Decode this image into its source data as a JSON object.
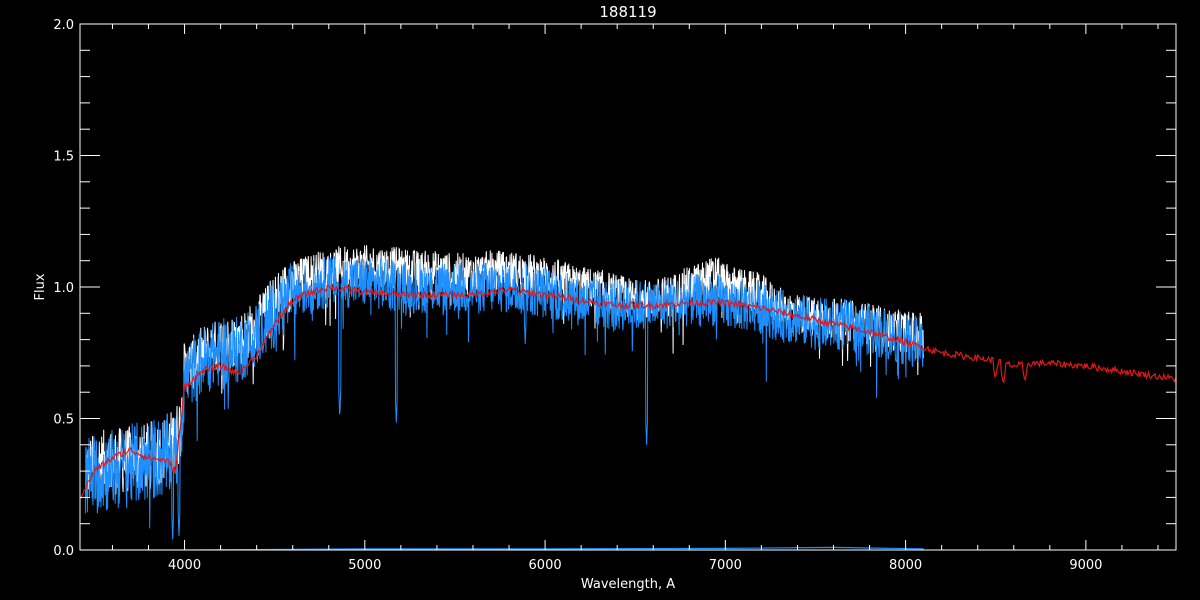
{
  "chart_data": {
    "type": "line",
    "title": "188119",
    "xlabel": "Wavelength, A",
    "ylabel": "Flux",
    "xlim": [
      3420,
      9500
    ],
    "ylim": [
      0,
      2.0
    ],
    "x_ticks": [
      4000,
      5000,
      6000,
      7000,
      8000,
      9000
    ],
    "x_tick_labels": [
      "4000",
      "5000",
      "6000",
      "7000",
      "8000",
      "9000"
    ],
    "y_ticks": [
      0.0,
      0.5,
      1.0,
      1.5,
      2.0
    ],
    "y_tick_labels": [
      "0.0",
      "0.5",
      "1.0",
      "1.5",
      "2.0"
    ],
    "grid": false,
    "background": "#000000",
    "axis_color": "#ffffff",
    "series": [
      {
        "color": "#ffffff",
        "style": "noisy spectrum (upper envelope)",
        "x": [
          3450,
          3550,
          3650,
          3750,
          3850,
          3920,
          3970,
          4000,
          4100,
          4200,
          4300,
          4400,
          4500,
          4600,
          4700,
          4800,
          4900,
          5000,
          5100,
          5200,
          5300,
          5400,
          5500,
          5600,
          5700,
          5800,
          5900,
          6000,
          6100,
          6200,
          6300,
          6400,
          6500,
          6600,
          6700,
          6800,
          6900,
          6950,
          7000,
          7100,
          7200,
          7300,
          7400,
          7500,
          7600,
          7700,
          7800,
          7900,
          8000,
          8100
        ],
        "y": [
          0.3,
          0.33,
          0.34,
          0.35,
          0.37,
          0.4,
          0.45,
          0.68,
          0.75,
          0.78,
          0.8,
          0.85,
          0.95,
          1.02,
          1.05,
          1.07,
          1.08,
          1.08,
          1.08,
          1.07,
          1.06,
          1.06,
          1.05,
          1.05,
          1.06,
          1.06,
          1.05,
          1.04,
          1.02,
          1.0,
          0.99,
          0.97,
          0.95,
          0.95,
          0.97,
          1.0,
          1.03,
          1.04,
          1.01,
          0.99,
          0.97,
          0.92,
          0.9,
          0.88,
          0.88,
          0.87,
          0.86,
          0.84,
          0.83,
          0.83
        ]
      },
      {
        "color": "#1e8fff",
        "style": "observed spectrum",
        "x": [
          3450,
          3550,
          3650,
          3750,
          3850,
          3920,
          3970,
          4000,
          4100,
          4200,
          4300,
          4400,
          4500,
          4600,
          4700,
          4800,
          4900,
          5000,
          5100,
          5200,
          5300,
          5400,
          5500,
          5600,
          5700,
          5800,
          5900,
          6000,
          6100,
          6200,
          6300,
          6400,
          6500,
          6600,
          6700,
          6800,
          6900,
          6950,
          7000,
          7100,
          7200,
          7300,
          7400,
          7500,
          7600,
          7700,
          7800,
          7900,
          8000,
          8100
        ],
        "y": [
          0.28,
          0.3,
          0.31,
          0.33,
          0.35,
          0.36,
          0.4,
          0.65,
          0.72,
          0.75,
          0.76,
          0.82,
          0.9,
          0.97,
          1.0,
          1.02,
          1.02,
          1.02,
          1.01,
          1.0,
          1.0,
          1.0,
          1.0,
          0.99,
          1.0,
          1.0,
          0.99,
          0.98,
          0.96,
          0.95,
          0.94,
          0.93,
          0.93,
          0.93,
          0.94,
          0.95,
          0.95,
          0.95,
          0.94,
          0.93,
          0.92,
          0.89,
          0.88,
          0.86,
          0.86,
          0.85,
          0.84,
          0.82,
          0.8,
          0.78
        ]
      },
      {
        "color": "#e01818",
        "style": "model spectrum",
        "x": [
          3420,
          3500,
          3600,
          3700,
          3800,
          3900,
          3950,
          4000,
          4100,
          4200,
          4300,
          4400,
          4500,
          4600,
          4700,
          4800,
          4900,
          5000,
          5200,
          5400,
          5600,
          5800,
          6000,
          6200,
          6400,
          6600,
          6800,
          7000,
          7200,
          7400,
          7600,
          7800,
          8000,
          8200,
          8400,
          8500,
          8600,
          8700,
          8800,
          9000,
          9200,
          9400,
          9500
        ],
        "y": [
          0.2,
          0.3,
          0.35,
          0.38,
          0.35,
          0.34,
          0.3,
          0.62,
          0.68,
          0.7,
          0.67,
          0.74,
          0.86,
          0.95,
          0.98,
          1.0,
          0.99,
          0.98,
          0.97,
          0.97,
          0.97,
          0.99,
          0.97,
          0.95,
          0.93,
          0.93,
          0.94,
          0.94,
          0.92,
          0.89,
          0.86,
          0.83,
          0.79,
          0.75,
          0.73,
          0.72,
          0.7,
          0.71,
          0.71,
          0.7,
          0.68,
          0.66,
          0.65
        ]
      },
      {
        "color": "#1e8fff",
        "style": "error / residual near zero",
        "x": [
          3420,
          4000,
          5000,
          6000,
          7000,
          7600,
          8100
        ],
        "y": [
          0.0,
          0.0,
          0.004,
          0.004,
          0.006,
          0.01,
          0.004
        ]
      }
    ],
    "absorption_features": [
      {
        "x": 3934,
        "y_min": 0.04
      },
      {
        "x": 3969,
        "y_min": 0.05
      },
      {
        "x": 4861,
        "y_min": 0.5
      },
      {
        "x": 5175,
        "y_min": 0.48
      },
      {
        "x": 5890,
        "y_min": 0.78
      },
      {
        "x": 6563,
        "y_min": 0.4
      }
    ],
    "model_absorption_features": [
      {
        "x": 8498,
        "y_min": 0.65
      },
      {
        "x": 8542,
        "y_min": 0.63
      },
      {
        "x": 8662,
        "y_min": 0.64
      }
    ]
  }
}
